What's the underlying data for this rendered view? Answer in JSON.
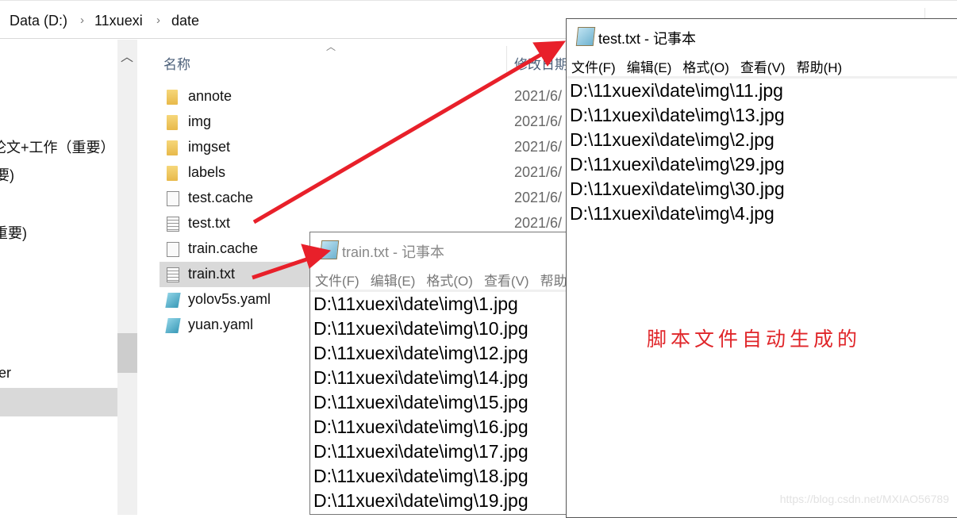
{
  "explorer": {
    "breadcrumb": [
      "Data (D:)",
      "11xuexi",
      "date"
    ],
    "sidebar": [
      "论文+工作（重要）",
      "要)",
      "重要)",
      "er"
    ],
    "columns": {
      "name": "名称",
      "modified": "修改日期"
    },
    "files": [
      {
        "name": "annote",
        "icon": "folder-icon",
        "date": "2021/6/"
      },
      {
        "name": "img",
        "icon": "folder-icon",
        "date": "2021/6/"
      },
      {
        "name": "imgset",
        "icon": "folder-icon",
        "date": "2021/6/"
      },
      {
        "name": "labels",
        "icon": "folder-icon",
        "date": "2021/6/"
      },
      {
        "name": "test.cache",
        "icon": "file-icon",
        "date": "2021/6/"
      },
      {
        "name": "test.txt",
        "icon": "text-file-icon",
        "date": "2021/6/"
      },
      {
        "name": "train.cache",
        "icon": "file-icon"
      },
      {
        "name": "train.txt",
        "icon": "text-file-icon",
        "selected": true
      },
      {
        "name": "yolov5s.yaml",
        "icon": "yaml-file-icon"
      },
      {
        "name": "yuan.yaml",
        "icon": "yaml-file-icon"
      }
    ]
  },
  "notepad_test": {
    "title": "test.txt - 记事本",
    "menu": [
      "文件(F)",
      "编辑(E)",
      "格式(O)",
      "查看(V)",
      "帮助(H)"
    ],
    "lines": [
      "D:\\11xuexi\\date\\img\\11.jpg",
      "D:\\11xuexi\\date\\img\\13.jpg",
      "D:\\11xuexi\\date\\img\\2.jpg",
      "D:\\11xuexi\\date\\img\\29.jpg",
      "D:\\11xuexi\\date\\img\\30.jpg",
      "D:\\11xuexi\\date\\img\\4.jpg"
    ]
  },
  "notepad_train": {
    "title": "train.txt - 记事本",
    "menu": [
      "文件(F)",
      "编辑(E)",
      "格式(O)",
      "查看(V)",
      "帮助(H)"
    ],
    "lines": [
      "D:\\11xuexi\\date\\img\\1.jpg",
      "D:\\11xuexi\\date\\img\\10.jpg",
      "D:\\11xuexi\\date\\img\\12.jpg",
      "D:\\11xuexi\\date\\img\\14.jpg",
      "D:\\11xuexi\\date\\img\\15.jpg",
      "D:\\11xuexi\\date\\img\\16.jpg",
      "D:\\11xuexi\\date\\img\\17.jpg",
      "D:\\11xuexi\\date\\img\\18.jpg",
      "D:\\11xuexi\\date\\img\\19.jpg"
    ]
  },
  "annotation": "脚本文件自动生成的",
  "watermark": "https://blog.csdn.net/MXIAO56789",
  "colors": {
    "arrow": "#e8202a",
    "annotation": "#e0262a",
    "selection": "#d9d9d9"
  }
}
